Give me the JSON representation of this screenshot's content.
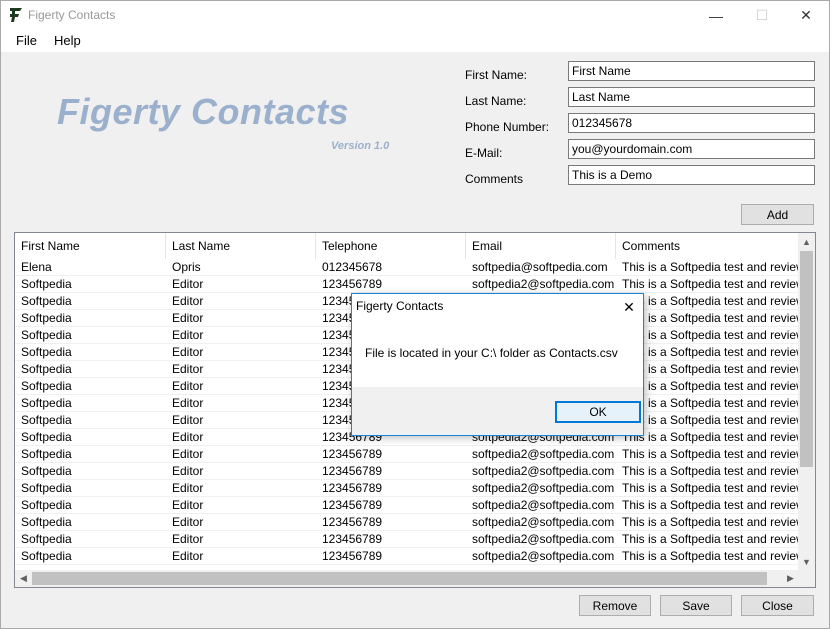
{
  "window": {
    "title": "Figerty Contacts",
    "minimize": "—",
    "maximize": "☐",
    "close": "✕"
  },
  "menu": {
    "file": "File",
    "help": "Help"
  },
  "logo": {
    "title": "Figerty Contacts",
    "version": "Version 1.0"
  },
  "form": {
    "first_name_label": "First Name:",
    "first_name_value": "First Name",
    "last_name_label": "Last Name:",
    "last_name_value": "Last Name",
    "phone_label": "Phone Number:",
    "phone_value": "012345678",
    "email_label": "E-Mail:",
    "email_value": "you@yourdomain.com",
    "comments_label": "Comments",
    "comments_value": "This is a Demo",
    "add_label": "Add"
  },
  "grid": {
    "columns": [
      "First Name",
      "Last Name",
      "Telephone",
      "Email",
      "Comments"
    ],
    "rows": [
      [
        "Elena",
        "Opris",
        "012345678",
        "softpedia@softpedia.com",
        "This is a Softpedia test and review"
      ],
      [
        "Softpedia",
        "Editor",
        "123456789",
        "softpedia2@softpedia.com",
        "This is a Softpedia test and review"
      ],
      [
        "Softpedia",
        "Editor",
        "123456789",
        "softpedia2@softpedia.com",
        "This is a Softpedia test and review"
      ],
      [
        "Softpedia",
        "Editor",
        "123456789",
        "softpedia2@softpedia.com",
        "This is a Softpedia test and review"
      ],
      [
        "Softpedia",
        "Editor",
        "123456789",
        "softpedia2@softpedia.com",
        "This is a Softpedia test and review"
      ],
      [
        "Softpedia",
        "Editor",
        "123456789",
        "softpedia2@softpedia.com",
        "This is a Softpedia test and review"
      ],
      [
        "Softpedia",
        "Editor",
        "123456789",
        "softpedia2@softpedia.com",
        "This is a Softpedia test and review"
      ],
      [
        "Softpedia",
        "Editor",
        "123456789",
        "softpedia2@softpedia.com",
        "This is a Softpedia test and review"
      ],
      [
        "Softpedia",
        "Editor",
        "123456789",
        "softpedia2@softpedia.com",
        "This is a Softpedia test and review"
      ],
      [
        "Softpedia",
        "Editor",
        "123456789",
        "softpedia2@softpedia.com",
        "This is a Softpedia test and review"
      ],
      [
        "Softpedia",
        "Editor",
        "123456789",
        "softpedia2@softpedia.com",
        "This is a Softpedia test and review"
      ],
      [
        "Softpedia",
        "Editor",
        "123456789",
        "softpedia2@softpedia.com",
        "This is a Softpedia test and review"
      ],
      [
        "Softpedia",
        "Editor",
        "123456789",
        "softpedia2@softpedia.com",
        "This is a Softpedia test and review"
      ],
      [
        "Softpedia",
        "Editor",
        "123456789",
        "softpedia2@softpedia.com",
        "This is a Softpedia test and review"
      ],
      [
        "Softpedia",
        "Editor",
        "123456789",
        "softpedia2@softpedia.com",
        "This is a Softpedia test and review"
      ],
      [
        "Softpedia",
        "Editor",
        "123456789",
        "softpedia2@softpedia.com",
        "This is a Softpedia test and review"
      ],
      [
        "Softpedia",
        "Editor",
        "123456789",
        "softpedia2@softpedia.com",
        "This is a Softpedia test and review"
      ],
      [
        "Softpedia",
        "Editor",
        "123456789",
        "softpedia2@softpedia.com",
        "This is a Softpedia test and review"
      ]
    ]
  },
  "buttons": {
    "remove": "Remove",
    "save": "Save",
    "close": "Close"
  },
  "dialog": {
    "title": "Figerty Contacts",
    "close": "✕",
    "message": "File is located in your C:\\ folder as Contacts.csv",
    "ok": "OK"
  },
  "colors": {
    "logo": "#9bb0cc",
    "accent": "#0078d7"
  }
}
